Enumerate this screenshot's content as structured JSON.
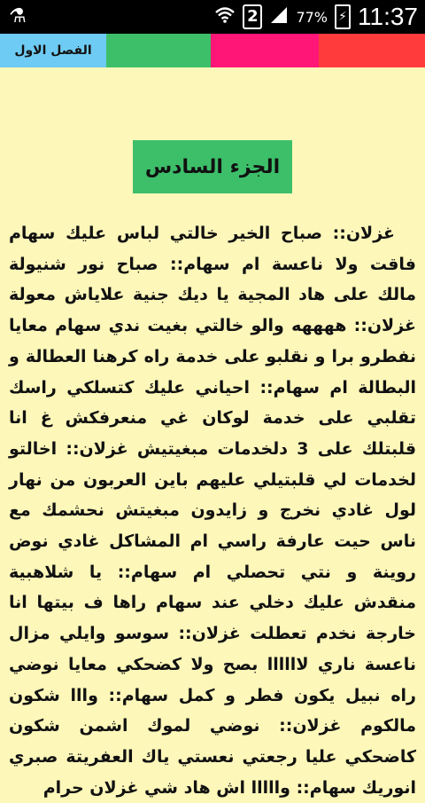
{
  "status_bar": {
    "usb_icon": "usb-icon",
    "battery_percent": "77%",
    "sim_badge": "2",
    "time": "11:37"
  },
  "tabs": [
    {
      "label": "الفصل الاول",
      "color": "#6ecbf3"
    },
    {
      "label": "",
      "color": "#3dbf6a"
    },
    {
      "label": "",
      "color": "#ff1677"
    },
    {
      "label": "",
      "color": "#ff3b3b"
    }
  ],
  "chapter_part": "الجزء السادس",
  "story_text": "غزلان:: صباح الخير خالتي لباس عليك سهام فاقت ولا ناعسة ام سهام:: صباح نور شنيولة مالك على هاد المجية يا ديك جنية علاياش معولة غزلان:: ههههه والو خالتي بغيت ندي سهام معايا نفطرو برا و نقلبو على خدمة راه كرهنا العطالة و البطالة ام سهام:: احياني عليك كتسلكي راسك تقلبي على خدمة لوكان غي منعرفكش غ انا قلبتلك على 3 دلخدمات مبغيتيش غزلان:: اخالتو لخدمات لي قلبتيلي عليهم باين العربون من نهار لول غادي نخرج و زايدون مبغيتش نحشمك مع ناس حيت عارفة راسي ام المشاكل غادي نوض روينة و نتي تحصلي ام سهام:: يا شلاهبية منقدش عليك دخلي عند سهام راها ف بيتها انا خارجة نخدم تعطلت غزلان:: سوسو وايلي مزال ناعسة ناري لاااااا بصح ولا كضحكي معايا نوضي راه نبيل يكون فطر و كمل سهام:: وااا شكون مالكوم غزلان:: نوضي لموك اشمن شكون كاضحكي عليا رجعتي نعستي ياك العفريتة صبري انوريك سهام:: وااااا اش هاد شي غزلان حرام"
}
